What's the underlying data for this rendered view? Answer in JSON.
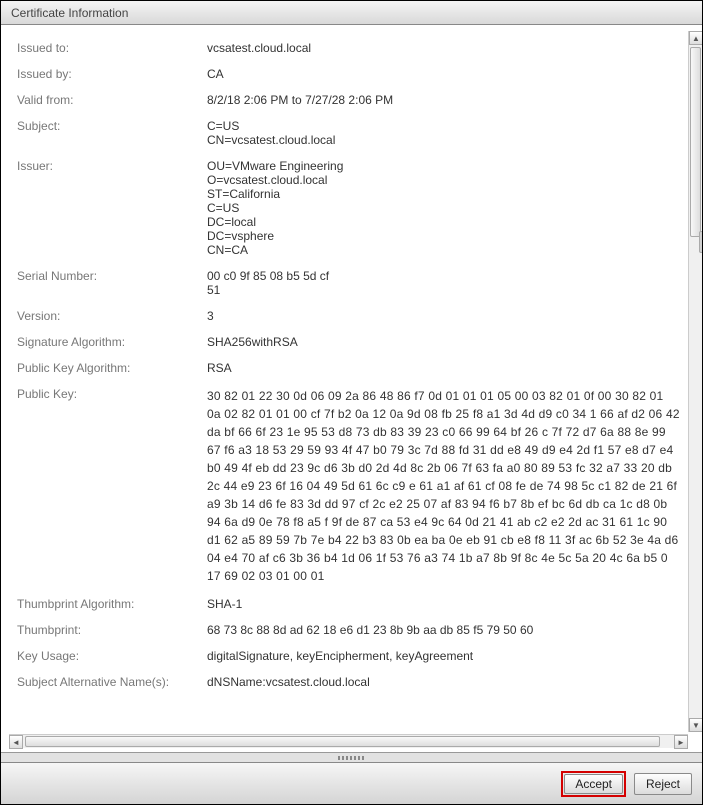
{
  "title": "Certificate Information",
  "fields": {
    "issued_to_label": "Issued to:",
    "issued_to": "vcsatest.cloud.local",
    "issued_by_label": "Issued by:",
    "issued_by": "CA",
    "valid_from_label": "Valid from:",
    "valid_from": "8/2/18 2:06 PM to 7/27/28 2:06 PM",
    "subject_label": "Subject:",
    "subject": "C=US\nCN=vcsatest.cloud.local",
    "issuer_label": "Issuer:",
    "issuer": "OU=VMware Engineering\nO=vcsatest.cloud.local\nST=California\nC=US\nDC=local\nDC=vsphere\nCN=CA",
    "serial_label": "Serial Number:",
    "serial": "00 c0 9f 85 08 b5 5d cf\n51",
    "version_label": "Version:",
    "version": "3",
    "sigalg_label": "Signature Algorithm:",
    "sigalg": "SHA256withRSA",
    "pkalg_label": "Public Key Algorithm:",
    "pkalg": "RSA",
    "pk_label": "Public Key:",
    "pk": "30 82 01 22 30 0d 06 09 2a 86 48 86 f7 0d 01 01 01 05 00 03 82 01 0f 00 30 82 01 0a 02 82 01 01 00 cf 7f b2 0a 12 0a 9d 08 fb 25 f8 a1 3d 4d d9 c0 34 1 66 af d2 06 42 da bf 66 6f 23 1e 95 53 d8 73 db 83 39 23 c0 66 99 64 bf 26 c 7f 72 d7 6a 88 8e 99 67 f6 a3 18 53 29 59 93 4f 47 b0 79 3c 7d 88 fd 31 dd e8 49 d9 e4 2d f1 57 e8 d7 e4 b0 49 4f eb dd 23 9c d6 3b d0 2d 4d 8c 2b 06 7f 63 fa a0 80 89 53 fc 32 a7 33 20 db 2c 44 e9 23 6f 16 04 49 5d 61 6c c9 e 61 a1 af 61 cf 08 fe de 74 98 5c c1 82 de 21 6f a9 3b 14 d6 fe 83 3d dd 97 cf 2c e2 25 07 af 83 94 f6 b7 8b ef bc 6d db ca 1c d8 0b 94 6a d9 0e 78 f8 a5 f 9f de 87 ca 53 e4 9c 64 0d 21 41 ab c2 e2 2d ac 31 61 1c 90 d1 62 a5 89 59 7b 7e b4 22 b3 83 0b ea ba 0e eb 91 cb e8 f8 11 3f ac 6b 52 3e 4a d6 04 e4 70 af c6 3b 36 b4 1d 06 1f 53 76 a3 74 1b a7 8b 9f 8c 4e 5c 5a 20 4c 6a b5 0 17 69 02 03 01 00 01",
    "thumbalg_label": "Thumbprint Algorithm:",
    "thumbalg": "SHA-1",
    "thumb_label": "Thumbprint:",
    "thumb": "68 73 8c 88 8d ad 62 18 e6 d1 23 8b 9b aa db 85 f5 79 50 60",
    "keyusage_label": "Key Usage:",
    "keyusage": "digitalSignature, keyEncipherment, keyAgreement",
    "san_label": "Subject Alternative Name(s):",
    "san": "dNSName:vcsatest.cloud.local"
  },
  "buttons": {
    "accept": "Accept",
    "reject": "Reject"
  }
}
